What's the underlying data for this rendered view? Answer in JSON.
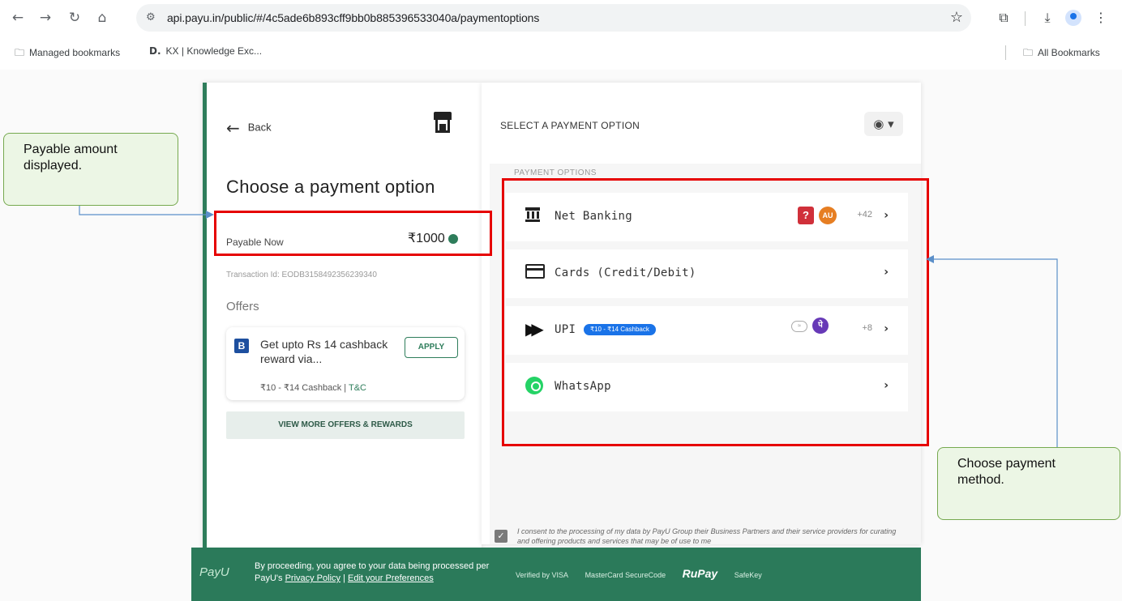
{
  "browser": {
    "url": "api.payu.in/public/#/4c5ade6b893cff9bb0b885396533040a/paymentoptions",
    "bookmarks": [
      {
        "label": "Managed bookmarks",
        "icon": "managed-bookmarks-folder-icon"
      },
      {
        "label": "KX | Knowledge Exc...",
        "icon": "d-favicon-icon"
      }
    ],
    "all_bookmarks": "All Bookmarks"
  },
  "left_panel": {
    "back_label": "Back",
    "title": "Choose a payment option",
    "payable_label": "Payable Now",
    "payable_amount": "₹1000",
    "transaction_id": "Transaction Id: EODB3158492356239340",
    "offers_title": "Offers",
    "offer": {
      "logo": "B",
      "text": "Get upto Rs 14 cashback reward via...",
      "apply": "APPLY",
      "cashback": "₹10 - ₹14 Cashback",
      "tc": "T&C"
    },
    "view_more": "VIEW MORE OFFERS & REWARDS"
  },
  "right_panel": {
    "title": "SELECT A PAYMENT OPTION",
    "section_label": "PAYMENT OPTIONS",
    "options": [
      {
        "label": "Net Banking",
        "extra": "+42",
        "icon": "bank-icon"
      },
      {
        "label": "Cards (Credit/Debit)",
        "icon": "card-icon"
      },
      {
        "label": "UPI",
        "pill": "₹10 - ₹14 Cashback",
        "extra": "+8",
        "icon": "upi-icon"
      },
      {
        "label": "WhatsApp",
        "icon": "whatsapp-icon"
      }
    ],
    "consent": "I consent to the processing of my data by PayU Group their Business Partners and their service providers for curating and offering products and services that may be of use to me"
  },
  "footer": {
    "logo": "PayU",
    "text_line1": "By proceeding, you agree to your data being processed per",
    "text_prefix": "PayU's",
    "privacy_link": "Privacy Policy",
    "divider": "|",
    "prefs_link": "Edit your Preferences",
    "brands": [
      "Verified by VISA",
      "MasterCard SecureCode",
      "RuPay",
      "SafeKey"
    ]
  },
  "annotations": {
    "left_callout": "Payable amount displayed.",
    "right_callout": "Choose payment method.",
    "highlight_color": "#e60000",
    "callout_bg": "#ecf6e5"
  }
}
